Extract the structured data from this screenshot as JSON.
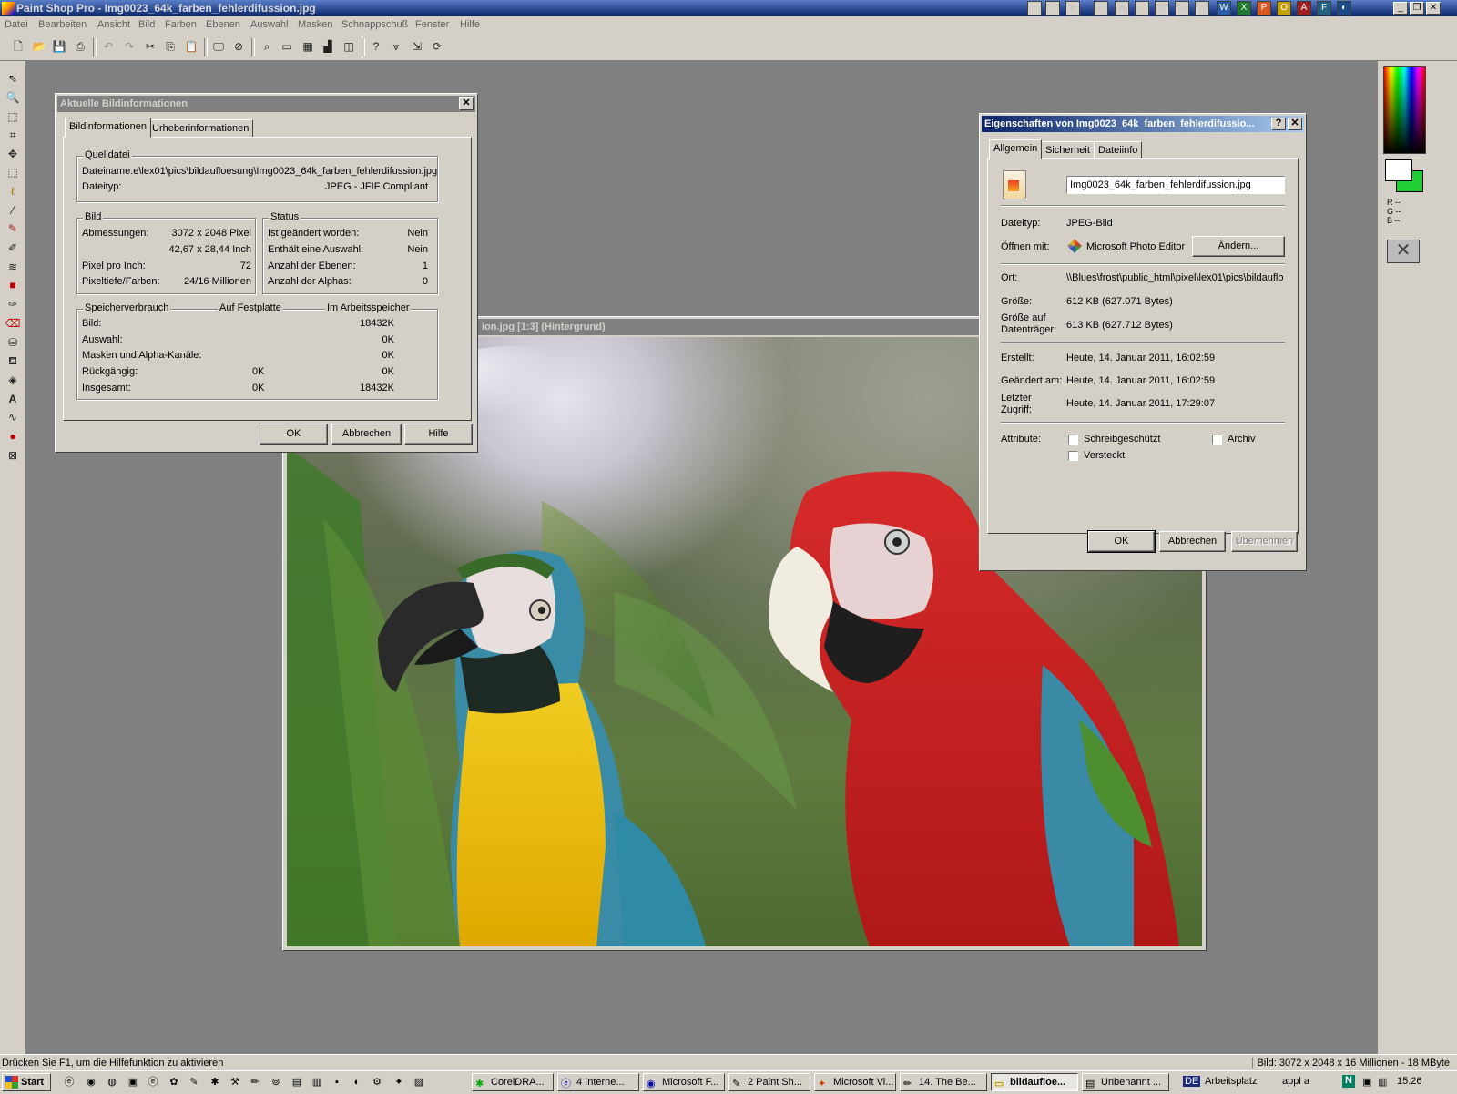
{
  "app": {
    "title": "Paint Shop Pro - Img0023_64k_farben_fehlerdifussion.jpg",
    "window_controls": [
      "_",
      "❐",
      "✕"
    ]
  },
  "menu": [
    "Datei",
    "Bearbeiten",
    "Ansicht",
    "Bild",
    "Farben",
    "Ebenen",
    "Auswahl",
    "Masken",
    "Schnappschuß",
    "Fenster",
    "Hilfe"
  ],
  "image_window": {
    "title": "ion.jpg [1:3] (Hintergrund)"
  },
  "info_dialog": {
    "title": "Aktuelle Bildinformationen",
    "tabs": [
      "Bildinformationen",
      "Urheberinformationen"
    ],
    "source": {
      "legend": "Quelldatei",
      "filename": "Dateiname:e\\lex01\\pics\\bildaufloesung\\Img0023_64k_farben_fehlerdifussion.jpg",
      "type_label": "Dateityp:",
      "type_value": "JPEG - JFIF Compliant"
    },
    "image": {
      "legend": "Bild",
      "dim_label": "Abmessungen:",
      "dim_px": "3072 x 2048 Pixel",
      "dim_in": "42,67 x 28,44 Inch",
      "ppi_label": "Pixel pro Inch:",
      "ppi_value": "72",
      "depth_label": "Pixeltiefe/Farben:",
      "depth_value": "24/16 Millionen"
    },
    "status": {
      "legend": "Status",
      "rows": [
        {
          "label": "Ist geändert worden:",
          "value": "Nein"
        },
        {
          "label": "Enthält eine Auswahl:",
          "value": "Nein"
        },
        {
          "label": "Anzahl der Ebenen:",
          "value": "1"
        },
        {
          "label": "Anzahl der Alphas:",
          "value": "0"
        }
      ]
    },
    "memory": {
      "legend": "Speicherverbrauch",
      "col_disk": "Auf Festplatte",
      "col_ram": "Im Arbeitsspeicher",
      "rows": [
        {
          "label": "Bild:",
          "disk": "",
          "ram": "18432K"
        },
        {
          "label": "Auswahl:",
          "disk": "",
          "ram": "0K"
        },
        {
          "label": "Masken und Alpha-Kanäle:",
          "disk": "",
          "ram": "0K"
        },
        {
          "label": "Rückgängig:",
          "disk": "0K",
          "ram": "0K"
        },
        {
          "label": "Insgesamt:",
          "disk": "0K",
          "ram": "18432K"
        }
      ]
    },
    "buttons": {
      "ok": "OK",
      "cancel": "Abbrechen",
      "help": "Hilfe"
    }
  },
  "props_dialog": {
    "title": "Eigenschaften von Img0023_64k_farben_fehlerdifussio...",
    "help_btn": "?",
    "tabs": [
      "Allgemein",
      "Sicherheit",
      "Dateiinfo"
    ],
    "filename": "Img0023_64k_farben_fehlerdifussion.jpg",
    "type_label": "Dateityp:",
    "type_value": "JPEG-Bild",
    "open_label": "Öffnen mit:",
    "open_value": "Microsoft Photo Editor",
    "change_btn": "Ändern...",
    "location_label": "Ort:",
    "location_value": "\\\\Blues\\frost\\public_html\\pixel\\lex01\\pics\\bildauflo",
    "size_label": "Größe:",
    "size_value": "612 KB (627.071 Bytes)",
    "disk_label_1": "Größe auf",
    "disk_label_2": "Datenträger:",
    "disk_value": "613 KB (627.712 Bytes)",
    "created_label": "Erstellt:",
    "created_value": "Heute, 14. Januar 2011, 16:02:59",
    "modified_label": "Geändert am:",
    "modified_value": "Heute, 14. Januar 2011, 16:02:59",
    "access_label_1": "Letzter",
    "access_label_2": "Zugriff:",
    "access_value": "Heute, 14. Januar 2011, 17:29:07",
    "attr_label": "Attribute:",
    "attr_readonly": "Schreibgeschützt",
    "attr_hidden": "Versteckt",
    "attr_archive": "Archiv",
    "buttons": {
      "ok": "OK",
      "cancel": "Abbrechen",
      "apply": "Übernehmen"
    }
  },
  "colors": {
    "r": "R --",
    "g": "G --",
    "b": "B --"
  },
  "status_bar": {
    "hint": "Drücken Sie F1, um die Hilfefunktion zu aktivieren",
    "image_info": "Bild:  3072 x 2048 x 16 Millionen - 18 MByte"
  },
  "taskbar": {
    "start": "Start",
    "tasks": [
      "CorelDRA...",
      "4 Interne...",
      "Microsoft F...",
      "2 Paint Sh...",
      "Microsoft Vi...",
      "14. The Be...",
      "bildaufloe...",
      "Unbenannt ..."
    ],
    "lang": "DE",
    "workspace": "Arbeitsplatz",
    "appl": "appl a",
    "clock": "15:26"
  }
}
